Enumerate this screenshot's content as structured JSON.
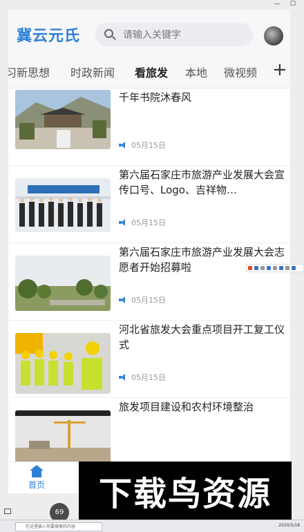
{
  "app": {
    "logo": "冀云元氏"
  },
  "search": {
    "placeholder": "请输入关键字"
  },
  "tabs": [
    {
      "label": "习新思想"
    },
    {
      "label": "时政新闻"
    },
    {
      "label": "看旅发"
    },
    {
      "label": "本地"
    },
    {
      "label": "微视频"
    }
  ],
  "tab_add": "+",
  "news": [
    {
      "title": "千年书院沐春风",
      "date": "05月15日"
    },
    {
      "title": "第六届石家庄市旅游产业发展大会宣传口号、Logo、吉祥物…",
      "date": "05月15日"
    },
    {
      "title": "第六届石家庄市旅游产业发展大会志愿者开始招募啦",
      "date": "05月15日"
    },
    {
      "title": "河北省旅发大会重点项目开工复工仪式",
      "date": "05月15日"
    },
    {
      "title": "旅发项目建设和农村环境整治",
      "date": ""
    }
  ],
  "bottom_nav": {
    "home": "首页"
  },
  "watermark": "下载鸟资源",
  "taskbar": {
    "search": "在这里输入你要搜索的内容",
    "date": "2020/5/18",
    "badge": "69"
  },
  "colors": {
    "accent": "#2e80d6",
    "active_tab": "#222222"
  }
}
